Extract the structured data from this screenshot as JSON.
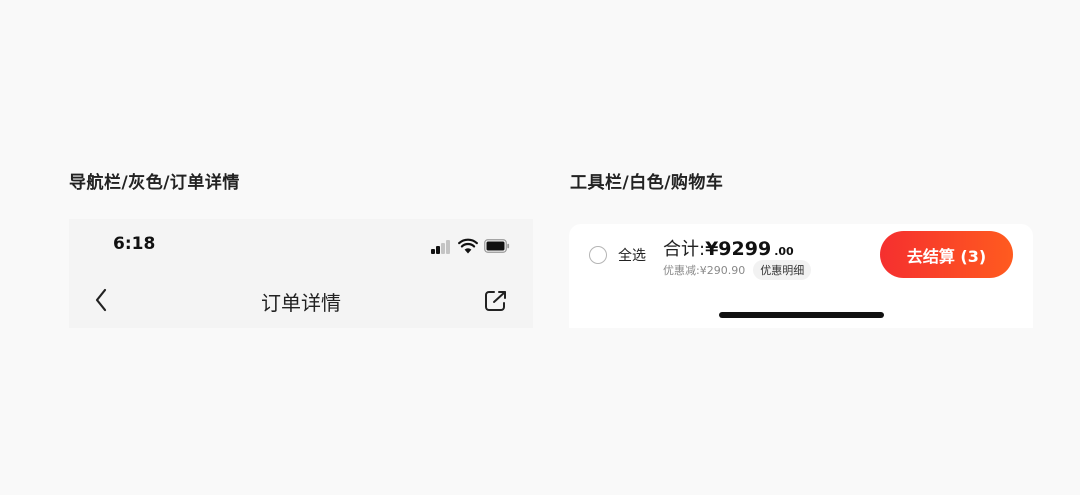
{
  "labels": {
    "left": "导航栏/灰色/订单详情",
    "right": "工具栏/白色/购物车"
  },
  "status_bar": {
    "time": "6:18",
    "icons": [
      "signal-icon",
      "wifi-icon",
      "battery-icon"
    ]
  },
  "navbar": {
    "title": "订单详情",
    "back_icon": "chevron-left-icon",
    "share_icon": "share-icon",
    "background": "#f4f4f4"
  },
  "cart_toolbar": {
    "select_all_label": "全选",
    "total_label": "合计:",
    "total_integer": "¥9299",
    "total_decimal": ".00",
    "discount_text": "优惠减:¥290.90",
    "discount_detail_label": "优惠明细",
    "checkout_label": "去结算 (3)",
    "accent_color": "#f52f2f",
    "accent_color_end": "#ff5b1f"
  }
}
